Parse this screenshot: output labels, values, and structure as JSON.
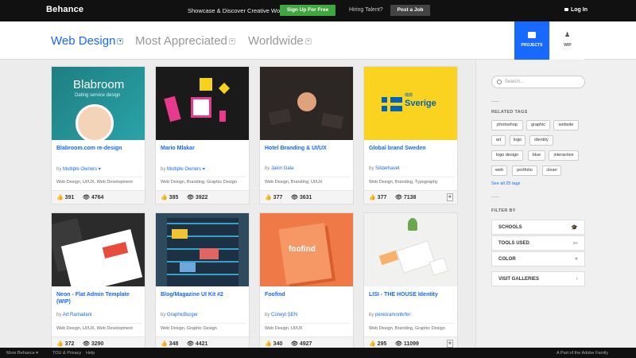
{
  "header": {
    "logo": "Behance",
    "tagline": "Showcase & Discover Creative Work",
    "signup": "Sign Up For Free",
    "hiring": "Hiring Talent?",
    "post_job": "Post a Job",
    "login": "Log In"
  },
  "filters": {
    "field": "Web Design",
    "sort": "Most Appreciated",
    "location": "Worldwide"
  },
  "tabs": {
    "projects": "PROJECTS",
    "wip": "WIP"
  },
  "cards": [
    {
      "thumb_text": "Blabroom",
      "thumb_sub": "Dating service design",
      "title": "Blabroom.com re-design",
      "by_prefix": "by",
      "author": "Multiple Owners",
      "fields": "Web Design, UI/UX, Web Development",
      "likes": "391",
      "views": "4764"
    },
    {
      "title": "Mario Mlakar",
      "by_prefix": "by",
      "author": "Multiple Owners",
      "fields": "Web Design, Branding, Graphic Design",
      "likes": "385",
      "views": "3922"
    },
    {
      "title": "Hotel Branding & UI/UX",
      "by_prefix": "by",
      "author": "Jakin Gala",
      "fields": "Web Design, Branding, UI/UX",
      "likes": "377",
      "views": "3631"
    },
    {
      "thumb_text": "Sverige",
      "thumb_sub": "瑞典",
      "title": "Global brand Sweden",
      "by_prefix": "by",
      "author": "Söderhavet",
      "fields": "Web Design, Branding, Typography",
      "likes": "377",
      "views": "7138"
    },
    {
      "title": "Neon - Flat Admin Template (WIP)",
      "by_prefix": "by",
      "author": "Art Ramadani",
      "fields": "Web Design, UI/UX, Web Development",
      "likes": "372",
      "views": "3290"
    },
    {
      "title": "Blog/Magazine UI Kit #2",
      "by_prefix": "by",
      "author": "GraphicBurger",
      "fields": "Web Design, Graphic Design",
      "likes": "348",
      "views": "4421"
    },
    {
      "thumb_text": "foofind",
      "title": "Foofind",
      "by_prefix": "by",
      "author": "Cüneyt ŞEN",
      "fields": "Web Design, UI/UX",
      "likes": "340",
      "views": "4927"
    },
    {
      "title": "LISI - THE HOUSE Identity",
      "by_prefix": "by",
      "author": "perezramonbrfer",
      "fields": "Web Design, Branding, Graphic Design",
      "likes": "295",
      "views": "11099"
    }
  ],
  "sidebar": {
    "search_placeholder": "Search...",
    "related_tags_heading": "RELATED TAGS",
    "tags": [
      "photoshop",
      "graphic",
      "website",
      "art",
      "logo",
      "identity",
      "logo design",
      "blue",
      "interactive",
      "web",
      "portfolio",
      "clean"
    ],
    "see_all": "See all 25 tags",
    "filter_by": "FILTER BY",
    "schools": "SCHOOLS",
    "tools": "TOOLS USED",
    "color": "COLOR",
    "visit_galleries": "VISIT GALLERIES"
  },
  "footer": {
    "more": "More Behance ▾",
    "tou": "TOU & Privacy",
    "help": "Help",
    "adobe": "Part of the Adobe Family"
  },
  "colors": {
    "accent": "#1769ff",
    "signup_green": "#3fa73f",
    "topbar": "#111111"
  }
}
